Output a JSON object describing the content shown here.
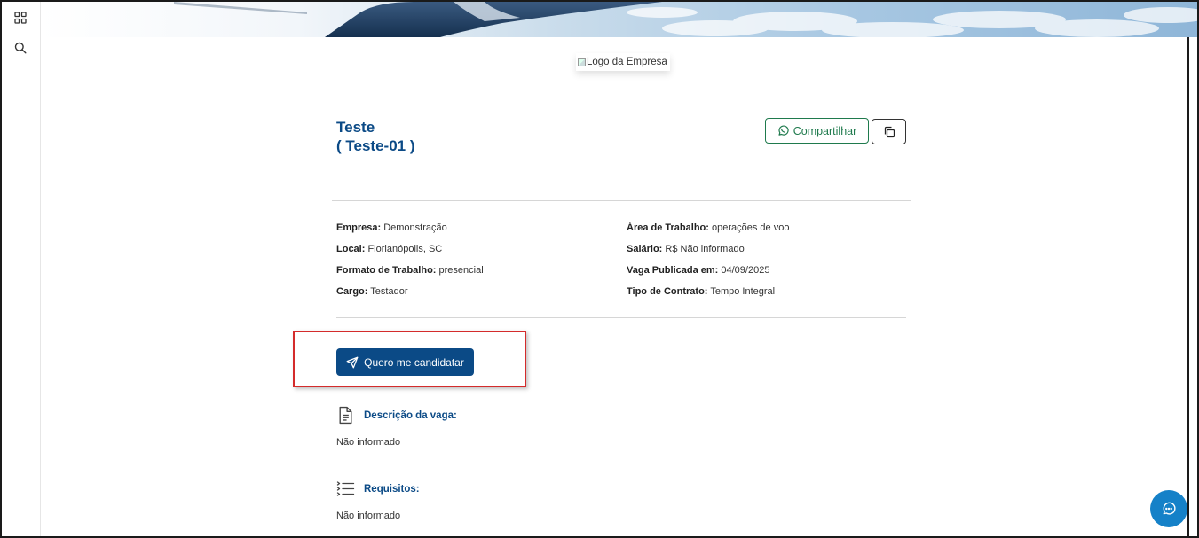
{
  "rail": {
    "items": [
      {
        "icon": "grid-icon"
      },
      {
        "icon": "search-icon"
      }
    ]
  },
  "logo": {
    "alt": "Logo da Empresa"
  },
  "job": {
    "title": "Teste",
    "code": "( Teste-01 )"
  },
  "actions": {
    "share_label": "Compartilhar",
    "share_icon": "whatsapp-icon",
    "copy_icon": "copy-icon"
  },
  "details": {
    "left": [
      {
        "label": "Empresa:",
        "value": " Demonstração"
      },
      {
        "label": "Local:",
        "value": " Florianópolis, SC"
      },
      {
        "label": "Formato de Trabalho:",
        "value": " presencial"
      },
      {
        "label": "Cargo:",
        "value": " Testador"
      }
    ],
    "right": [
      {
        "label": "Área de Trabalho:",
        "value": " operações de voo"
      },
      {
        "label": "Salário:",
        "value": " R$ Não informado"
      },
      {
        "label": "Vaga Publicada em:",
        "value": " 04/09/2025"
      },
      {
        "label": "Tipo de Contrato:",
        "value": " Tempo Integral"
      }
    ]
  },
  "apply": {
    "label": "Quero me candidatar",
    "icon": "send-icon"
  },
  "sections": [
    {
      "icon": "document-icon",
      "title": "Descrição da vaga:",
      "body": "Não informado"
    },
    {
      "icon": "checklist-icon",
      "title": "Requisitos:",
      "body": "Não informado"
    }
  ],
  "colors": {
    "primary": "#0b4a86",
    "whatsapp": "#1f7a4d",
    "chat": "#1581c8",
    "highlight": "#d42b2b"
  },
  "chat": {
    "icon": "chat-icon"
  }
}
